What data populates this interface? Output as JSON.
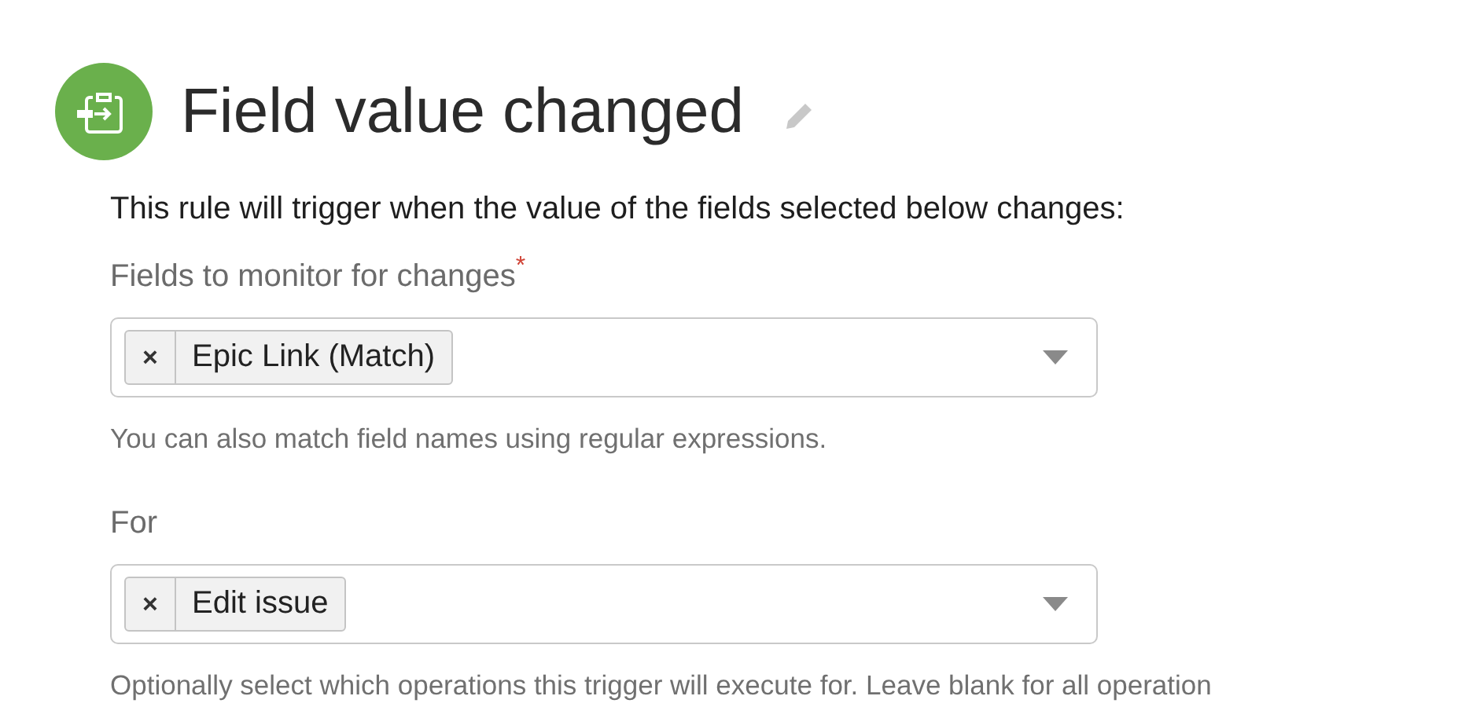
{
  "header": {
    "title": "Field value changed"
  },
  "description": "This rule will trigger when the value of the fields selected below changes:",
  "fields": [
    {
      "label": "Fields to monitor for changes",
      "required": true,
      "chips": [
        {
          "remove": "×",
          "text": "Epic Link (Match)"
        }
      ],
      "help": "You can also match field names using regular expressions."
    },
    {
      "label": "For",
      "required": false,
      "chips": [
        {
          "remove": "×",
          "text": "Edit issue"
        }
      ],
      "help": "Optionally select which operations this trigger will execute for. Leave blank for all operation"
    }
  ],
  "required_mark": "*"
}
